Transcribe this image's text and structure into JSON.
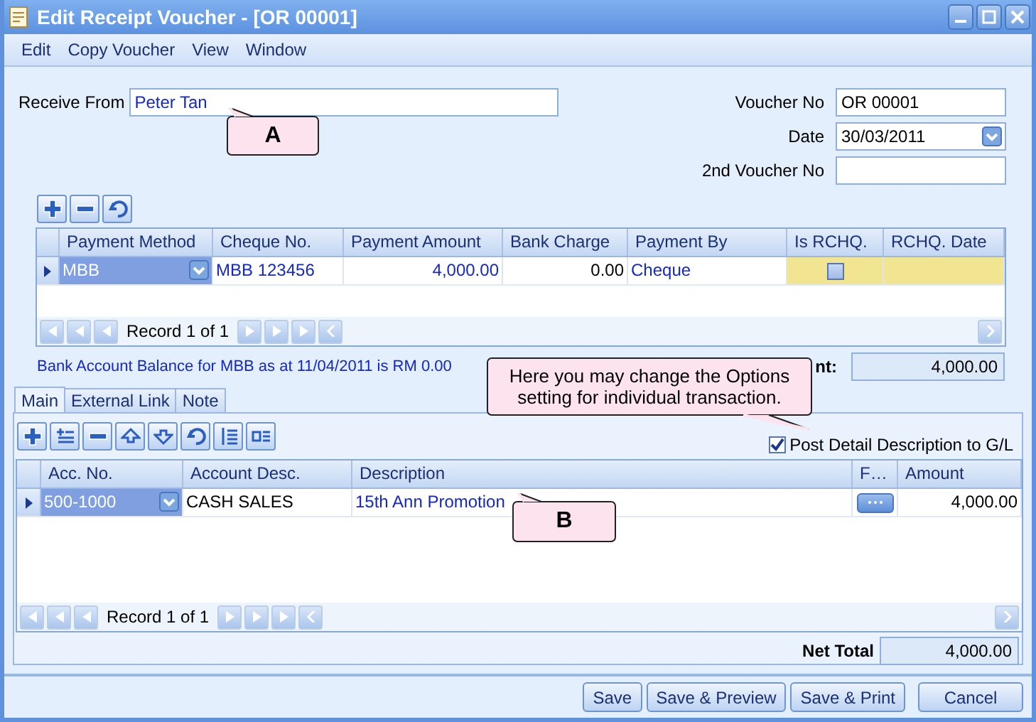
{
  "window": {
    "title": "Edit Receipt Voucher - [OR 00001]"
  },
  "menu": [
    "Edit",
    "Copy Voucher",
    "View",
    "Window"
  ],
  "receive_from": {
    "label": "Receive From",
    "value": "Peter Tan"
  },
  "voucher_fields": [
    {
      "label": "Voucher No",
      "value": "OR 00001",
      "kind": "text"
    },
    {
      "label": "Date",
      "value": "30/03/2011",
      "kind": "date"
    },
    {
      "label": "2nd Voucher No",
      "kind": "text"
    }
  ],
  "payment_grid": {
    "columns": [
      "Payment Method",
      "Cheque No.",
      "Payment Amount",
      "Bank Charge",
      "Payment By",
      "Is RCHQ.",
      "RCHQ. Date"
    ],
    "rows": [
      {
        "payment_method": "MBB",
        "cheque_no": "MBB 123456",
        "payment_amount": "4,000.00",
        "bank_charge": "0.00",
        "payment_by": "Cheque",
        "is_rchq": false,
        "selected": true
      }
    ],
    "navigator": "Record 1 of 1"
  },
  "balance_note": "Bank Account Balance for MBB as at 11/04/2011 is RM 0.00",
  "amount": {
    "label": "nt:",
    "value": "4,000.00"
  },
  "tabs": [
    {
      "label": "Main",
      "selected": true
    },
    {
      "label": "External Link",
      "selected": false
    },
    {
      "label": "Note",
      "selected": false
    }
  ],
  "post_detail": {
    "label": "Post Detail Description to G/L",
    "checked": true
  },
  "detail_grid": {
    "columns": [
      "Acc. No.",
      "Account Desc.",
      "Description",
      "F…",
      "Amount"
    ],
    "rows": [
      {
        "acc_no": "500-1000",
        "account_desc": "CASH SALES",
        "description": "15th Ann Promotion",
        "amount": "4,000.00",
        "selected": true
      }
    ],
    "navigator": "Record 1 of 1"
  },
  "net_total": {
    "label": "Net Total",
    "value": "4,000.00"
  },
  "buttons": [
    "Save",
    "Save & Preview",
    "Save & Print",
    "Cancel"
  ],
  "callouts": [
    {
      "text": "A"
    },
    {
      "text": "Here you may change the Options setting for individual transaction."
    },
    {
      "text": "B"
    }
  ]
}
